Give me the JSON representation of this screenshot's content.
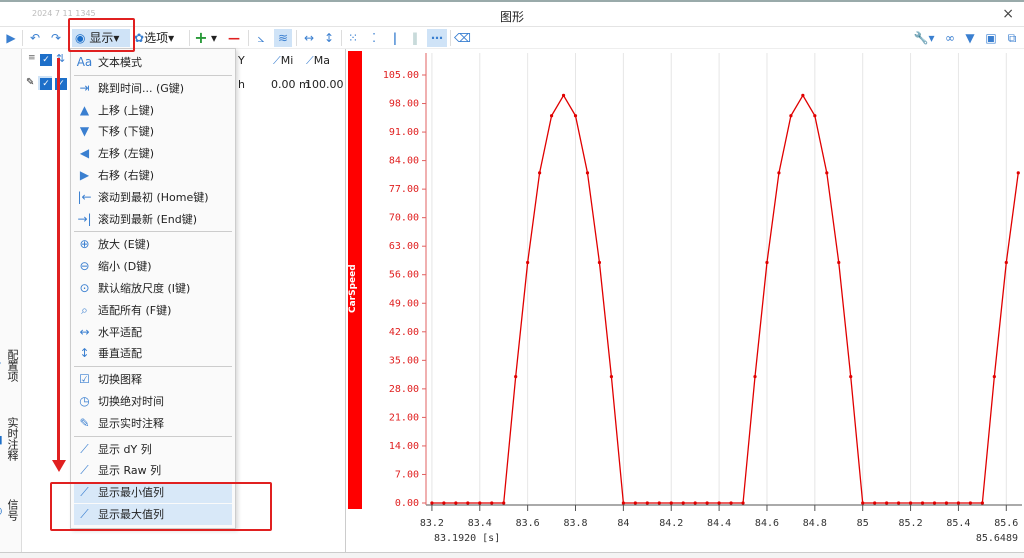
{
  "window": {
    "date": "2024 7 11 1345",
    "title": "图形",
    "close": "×"
  },
  "toolbar": {
    "play": "▶",
    "undo": "↶",
    "redo": "↷",
    "display_label": "显示",
    "options_label": "选项",
    "add": "+",
    "remove": "—",
    "dropdown": "▾"
  },
  "left_panel": {
    "header_y": "Y",
    "header_min": "Mi",
    "header_max": "Ma",
    "row_unit": "h",
    "row_min": "0.00 m",
    "row_max": "100.00"
  },
  "vertical_tabs": [
    "配置项",
    "实时注释",
    "信号"
  ],
  "menu": {
    "items": [
      {
        "icon": "Aa",
        "label": "文本模式"
      },
      {
        "icon": "⇥",
        "label": "跳到时间... (G键)"
      },
      {
        "icon": "▲",
        "label": "上移 (上键)"
      },
      {
        "icon": "▼",
        "label": "下移 (下键)"
      },
      {
        "icon": "◀",
        "label": "左移 (左键)"
      },
      {
        "icon": "▶",
        "label": "右移 (右键)"
      },
      {
        "icon": "|←",
        "label": "滚动到最初 (Home键)"
      },
      {
        "icon": "→|",
        "label": "滚动到最新 (End键)"
      },
      {
        "icon": "⊕",
        "label": "放大 (E键)"
      },
      {
        "icon": "⊖",
        "label": "缩小 (D键)"
      },
      {
        "icon": "⊙",
        "label": "默认缩放尺度 (I键)"
      },
      {
        "icon": "⌕",
        "label": "适配所有 (F键)"
      },
      {
        "icon": "↔",
        "label": "水平适配"
      },
      {
        "icon": "↕",
        "label": "垂直适配"
      },
      {
        "icon": "☑",
        "label": "切换图释"
      },
      {
        "icon": "◷",
        "label": "切换绝对时间"
      },
      {
        "icon": "✎",
        "label": "显示实时注释"
      },
      {
        "icon": "⟋",
        "label": "显示 dY 列"
      },
      {
        "icon": "⟋",
        "label": "显示 Raw 列"
      },
      {
        "icon": "⟋",
        "label": "显示最小值列"
      },
      {
        "icon": "⟋",
        "label": "显示最大值列"
      }
    ]
  },
  "colors": {
    "signal": "#e00000",
    "highlight": "#e02020",
    "accent": "#3a7fd0"
  },
  "chart_data": {
    "type": "line",
    "series_name": "CarSpeed",
    "ylim": [
      0,
      105
    ],
    "yticks": [
      "0.00",
      "7.00",
      "14.00",
      "21.00",
      "28.00",
      "35.00",
      "42.00",
      "49.00",
      "56.00",
      "63.00",
      "70.00",
      "77.00",
      "84.00",
      "91.00",
      "98.00",
      "105.00"
    ],
    "xlim": [
      83.192,
      85.6489
    ],
    "xticks": [
      "83.2",
      "83.4",
      "83.6",
      "83.8",
      "84",
      "84.2",
      "84.4",
      "84.6",
      "84.8",
      "85",
      "85.2",
      "85.4",
      "85.6"
    ],
    "x_start_label": "83.1920 [s]",
    "x_end_label": "85.6489",
    "x": [
      83.2,
      83.25,
      83.3,
      83.35,
      83.4,
      83.45,
      83.5,
      83.55,
      83.6,
      83.65,
      83.7,
      83.75,
      83.8,
      83.85,
      83.9,
      83.95,
      84.0,
      84.05,
      84.1,
      84.15,
      84.2,
      84.25,
      84.3,
      84.35,
      84.4,
      84.45,
      84.5,
      84.55,
      84.6,
      84.65,
      84.7,
      84.75,
      84.8,
      84.85,
      84.9,
      84.95,
      85.0,
      85.05,
      85.1,
      85.15,
      85.2,
      85.25,
      85.3,
      85.35,
      85.4,
      85.45,
      85.5,
      85.55,
      85.6,
      85.65
    ],
    "y": [
      0,
      0,
      0,
      0,
      0,
      0,
      0,
      31,
      59,
      81,
      95,
      100,
      95,
      81,
      59,
      31,
      0,
      0,
      0,
      0,
      0,
      0,
      0,
      0,
      0,
      0,
      0,
      31,
      59,
      81,
      95,
      100,
      95,
      81,
      59,
      31,
      0,
      0,
      0,
      0,
      0,
      0,
      0,
      0,
      0,
      0,
      0,
      31,
      59,
      81
    ]
  }
}
